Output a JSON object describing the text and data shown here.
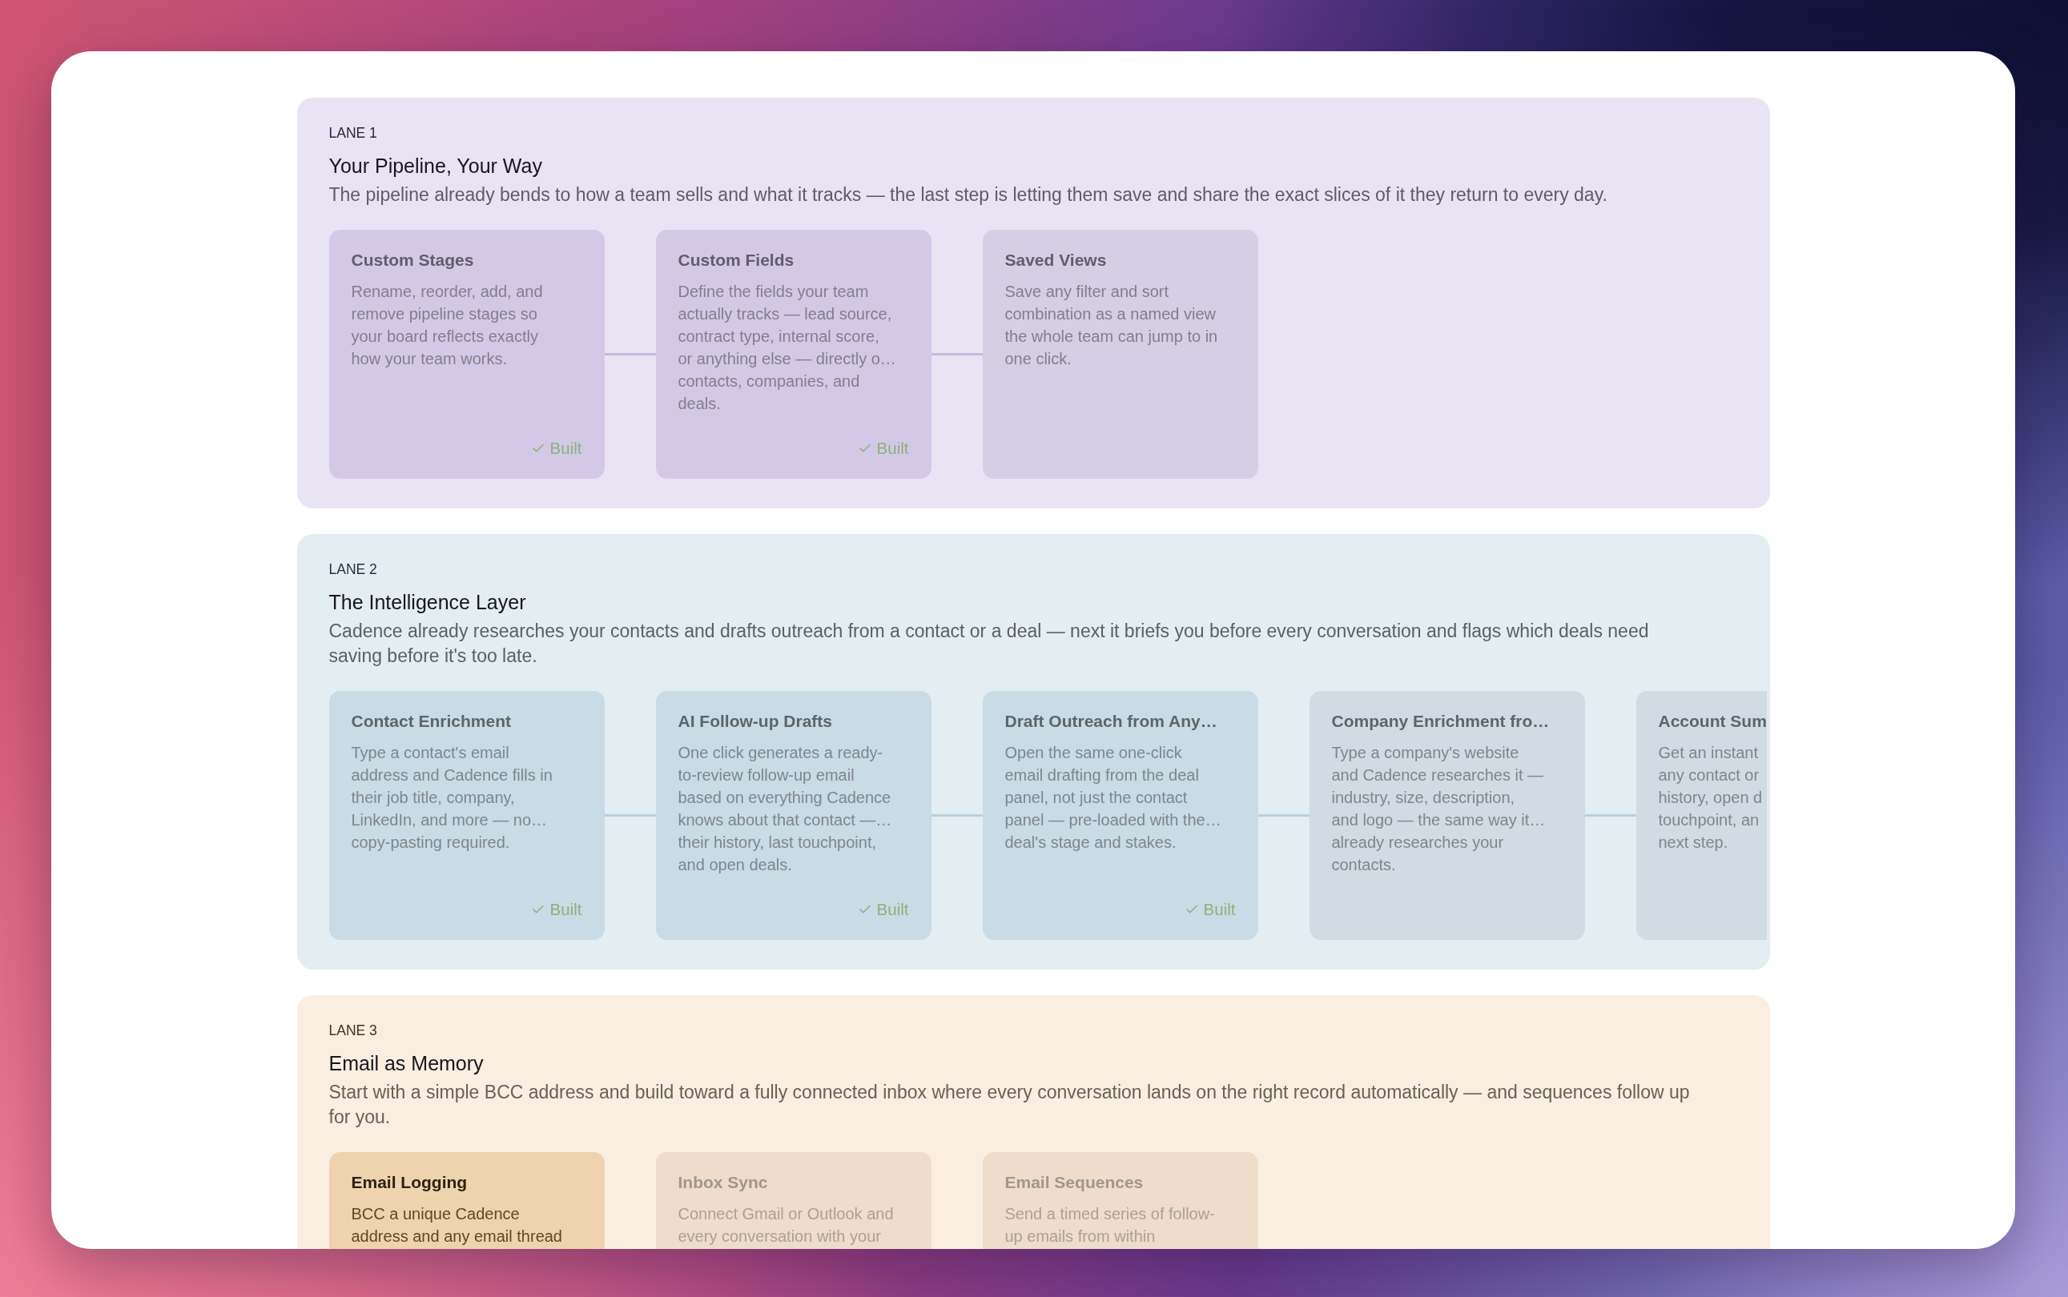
{
  "lanes": [
    {
      "label": "LANE 1",
      "title": "Your Pipeline, Your Way",
      "description": "The pipeline already bends to how a team sells and what it tracks — the last step is letting them save and share the exact slices of it they return to every day.",
      "color": "#e9e4f3",
      "cards": [
        {
          "kind": "built",
          "title": "Custom Stages",
          "description": "Rename, reorder, add, and\nremove pipeline stages so\nyour board reflects exactly\nhow your team works.",
          "badge": "Built"
        },
        {
          "kind": "built",
          "title": "Custom Fields",
          "description": "Define the fields your team\nactually tracks — lead source,\ncontract type, internal score,\nor anything else — directly o…\ncontacts, companies, and\ndeals.",
          "badge": "Built"
        },
        {
          "kind": "planned",
          "title": "Saved Views",
          "description": "Save any filter and sort\ncombination as a named view\nthe whole team can jump to in\none click."
        }
      ]
    },
    {
      "label": "LANE 2",
      "title": "The Intelligence Layer",
      "description": "Cadence already researches your contacts and drafts outreach from a contact or a deal — next it briefs you before every conversation and flags which deals need\nsaving before it's too late.",
      "color": "#e4edf2",
      "cards": [
        {
          "kind": "built",
          "title": "Contact Enrichment",
          "description": "Type a contact's email\naddress and Cadence fills in\ntheir job title, company,\nLinkedIn, and more — no…\ncopy-pasting required.",
          "badge": "Built"
        },
        {
          "kind": "built",
          "title": "AI Follow-up Drafts",
          "description": "One click generates a ready-\nto-review follow-up email\nbased on everything Cadence\nknows about that contact —…\ntheir history, last touchpoint,\nand open deals.",
          "badge": "Built"
        },
        {
          "kind": "built",
          "title": "Draft Outreach from Any…",
          "description": "Open the same one-click\nemail drafting from the deal\npanel, not just the contact\npanel — pre-loaded with the…\ndeal's stage and stakes.",
          "badge": "Built"
        },
        {
          "kind": "planned",
          "title": "Company Enrichment fro…",
          "description": "Type a company's website\nand Cadence researches it —\nindustry, size, description,\nand logo — the same way it…\nalready researches your\ncontacts."
        },
        {
          "kind": "planned",
          "title": "Account Sum",
          "description": "Get an instant\nany contact or\nhistory, open d\ntouchpoint, an\nnext step."
        }
      ]
    },
    {
      "label": "LANE 3",
      "title": "Email as Memory",
      "description": "Start with a simple BCC address and build toward a fully connected inbox where every conversation lands on the right record automatically — and sequences follow up\nfor you.",
      "color": "#f9eee0",
      "cards": [
        {
          "kind": "current",
          "title": "Email Logging",
          "description": "BCC a unique Cadence\naddress and any email thread"
        },
        {
          "kind": "upcoming",
          "title": "Inbox Sync",
          "description": "Connect Gmail or Outlook and\nevery conversation with your"
        },
        {
          "kind": "upcoming",
          "title": "Email Sequences",
          "description": "Send a timed series of follow-\nup emails from within"
        }
      ]
    }
  ]
}
